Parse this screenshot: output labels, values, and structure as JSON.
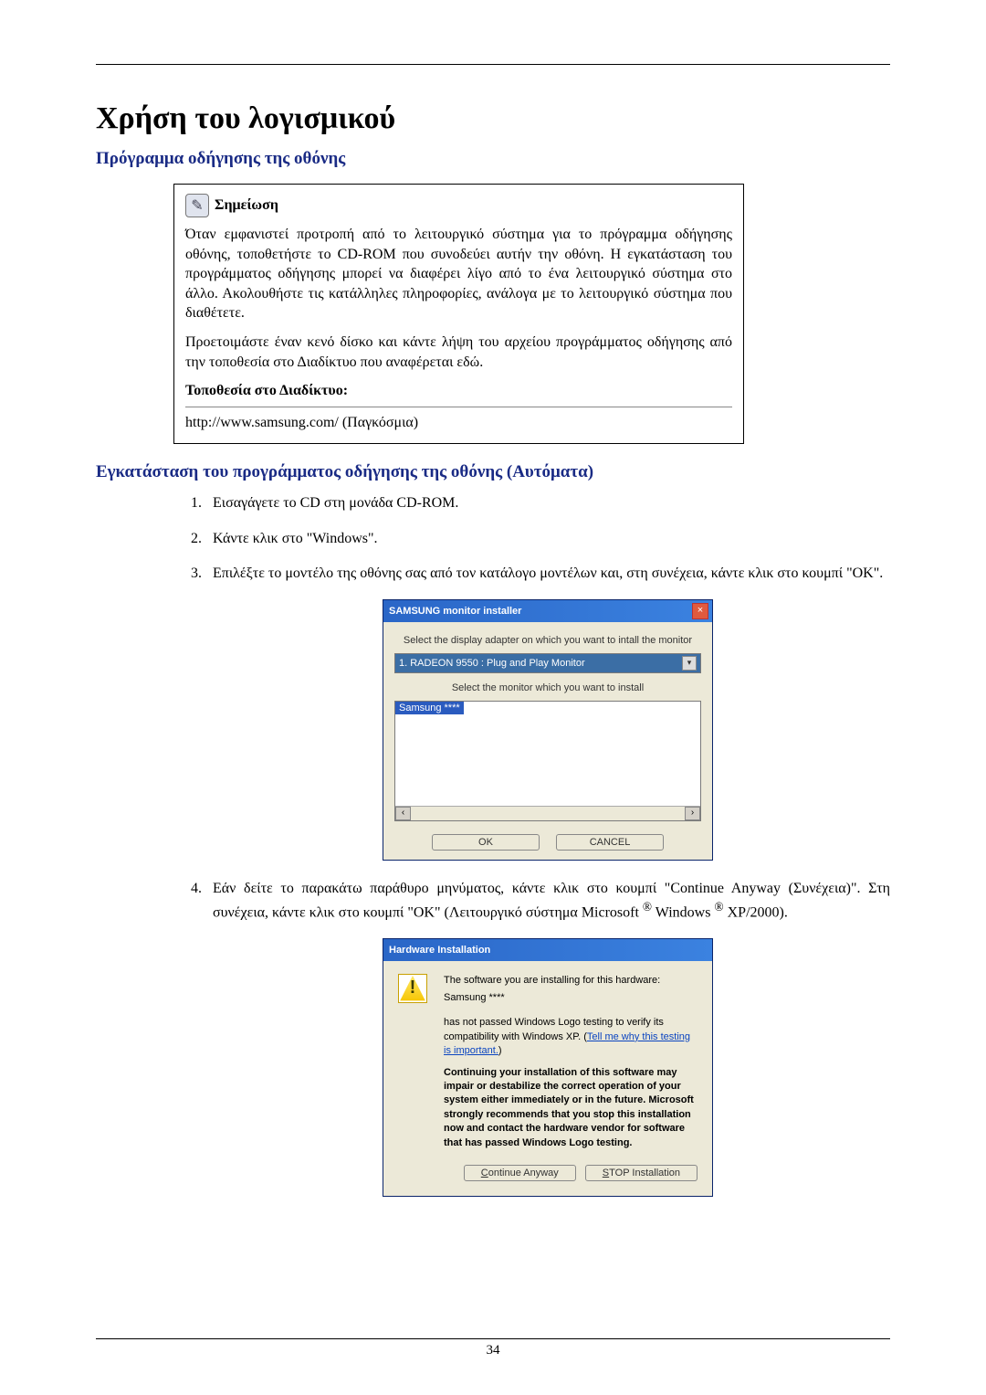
{
  "page": {
    "title": "Χρήση του λογισμικού",
    "section_driver_title": "Πρόγραμμα οδήγησης της οθόνης",
    "note": {
      "label": "Σημείωση",
      "para1": "Όταν εμφανιστεί προτροπή από το λειτουργικό σύστημα για το πρόγραμμα οδήγησης οθόνης, τοποθετήστε το CD-ROM που συνοδεύει αυτήν την οθόνη. Η εγκατάσταση του προγράμματος οδήγησης μπορεί να διαφέρει λίγο από το ένα λειτουργικό σύστημα στο άλλο. Ακολουθήστε τις κατάλληλες πληροφορίες, ανάλογα με το λειτουργικό σύστημα που διαθέτετε.",
      "para2": "Προετοιμάστε έναν κενό δίσκο και κάντε λήψη του αρχείου προγράμματος οδήγησης από την τοποθεσία στο Διαδίκτυο που αναφέρεται εδώ.",
      "site_label": "Τοποθεσία στο Διαδίκτυο:",
      "site_url": "http://www.samsung.com/ (Παγκόσμια)"
    },
    "install_heading": "Εγκατάσταση του προγράμματος οδήγησης της οθόνης (Αυτόματα)",
    "steps": [
      "Εισαγάγετε το CD στη μονάδα CD-ROM.",
      "Κάντε κλικ στο \"Windows\".",
      "Επιλέξτε το μοντέλο της οθόνης σας από τον κατάλογο μοντέλων και, στη συνέχεια, κάντε κλικ στο κουμπί \"OK\"."
    ],
    "step4_prefix": "Εάν δείτε το παρακάτω παράθυρο μηνύματος, κάντε κλικ στο κουμπί \"Continue Anyway (Συνέχεια)\". Στη συνέχεια, κάντε κλικ στο κουμπί \"OK\" (Λειτουργικό σύστημα Microsoft ",
    "step4_suffix": " Windows ",
    "step4_end": " XP/2000).",
    "reg": "®",
    "page_number": "34"
  },
  "installer": {
    "title": "SAMSUNG monitor installer",
    "close": "×",
    "msg1": "Select the display adapter on which you want to intall the monitor",
    "adapter": "1. RADEON 9550 : Plug and Play Monitor",
    "msg2": "Select the monitor which you want to install",
    "selected": "Samsung ****",
    "left_arrow": "‹",
    "right_arrow": "›",
    "drop_arrow": "▾",
    "ok": "OK",
    "cancel": "CANCEL"
  },
  "hw": {
    "title": "Hardware Installation",
    "excl": "!",
    "line1": "The software you are installing for this hardware:",
    "device": "Samsung ****",
    "line2a": "has not passed Windows Logo testing to verify its compatibility with Windows XP. (",
    "link": "Tell me why this testing is important.",
    "line2b": ")",
    "warn": "Continuing your installation of this software may impair or destabilize the correct operation of your system either immediately or in the future. Microsoft strongly recommends that you stop this installation now and contact the hardware vendor for software that has passed Windows Logo testing.",
    "btn_continue": "Continue Anyway",
    "btn_c": "C",
    "btn_stop": "STOP Installation",
    "btn_s": "S"
  }
}
